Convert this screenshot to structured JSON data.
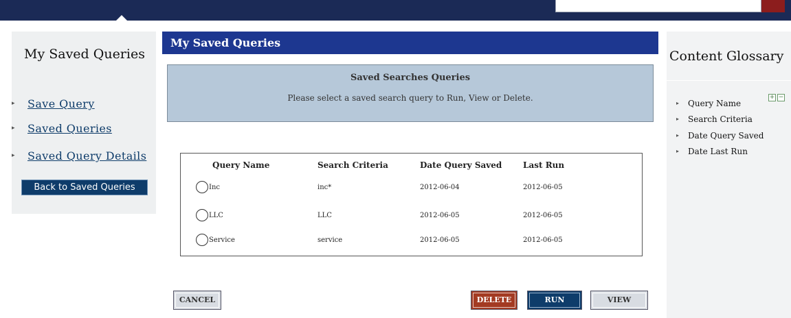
{
  "sidebar": {
    "title": "My Saved Queries",
    "links": [
      {
        "label": "Save Query"
      },
      {
        "label": "Saved Queries"
      },
      {
        "label": "Saved Query Details"
      }
    ],
    "back_button": "Back to Saved Queries"
  },
  "main": {
    "header": "My Saved Queries",
    "info": {
      "title": "Saved Searches Queries",
      "description": "Please select a saved search query to Run, View or Delete."
    },
    "table": {
      "columns": [
        "Query Name",
        "Search Criteria",
        "Date Query Saved",
        "Last Run"
      ],
      "rows": [
        {
          "name": "Inc",
          "criteria": "inc*",
          "saved": "2012-06-04",
          "last_run": "2012-06-05"
        },
        {
          "name": "LLC",
          "criteria": "LLC",
          "saved": "2012-06-05",
          "last_run": "2012-06-05"
        },
        {
          "name": "Service",
          "criteria": "service",
          "saved": "2012-06-05",
          "last_run": "2012-06-05"
        }
      ]
    },
    "buttons": {
      "cancel": "CANCEL",
      "delete": "DELETE",
      "run": "RUN",
      "view": "VIEW"
    }
  },
  "glossary": {
    "title": "Content Glossary",
    "expand_symbol": "+",
    "collapse_symbol": "−",
    "items": [
      "Query Name",
      "Search Criteria",
      "Date Query Saved",
      "Date Last Run"
    ]
  },
  "colors": {
    "top_bar": "#1b2a56",
    "header_blue": "#1d3790",
    "link_blue": "#0e3c6a",
    "delete_red": "#a33a22",
    "info_box": "#b6c8d9"
  }
}
